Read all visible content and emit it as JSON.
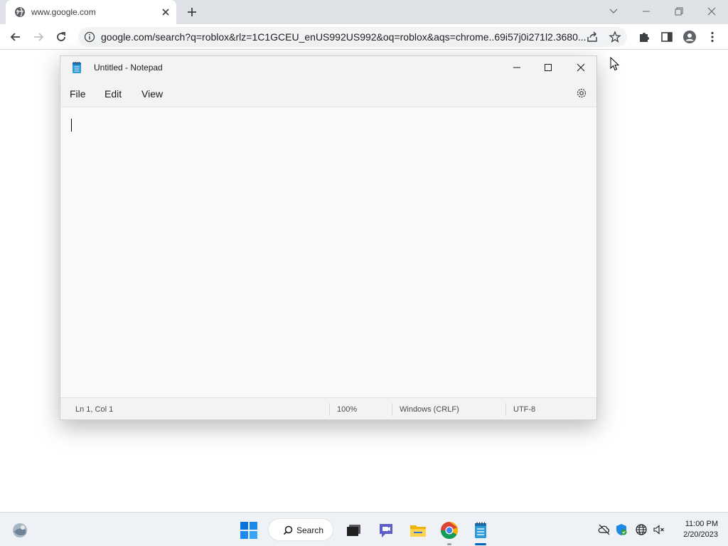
{
  "browser": {
    "tab": {
      "title": "www.google.com",
      "favicon": "globe-icon",
      "close_icon": "close-icon"
    },
    "new_tab_icon": "plus-icon",
    "window_controls": [
      "chevron-down-icon",
      "minimize-icon",
      "restore-icon",
      "close-icon"
    ],
    "toolbar": {
      "back_icon": "arrow-left-icon",
      "forward_icon": "arrow-right-icon",
      "reload_icon": "reload-icon",
      "url": "google.com/search?q=roblox&rlz=1C1GCEU_enUS992US992&oq=roblox&aqs=chrome..69i57j0i271l2.3680...",
      "extensions_icon": "puzzle-icon",
      "side_panel_icon": "side-panel-icon",
      "profile_icon": "person-icon",
      "menu_icon": "kebab-icon"
    }
  },
  "notepad": {
    "title": "Untitled - Notepad",
    "menu": [
      "File",
      "Edit",
      "View"
    ],
    "content": "",
    "status": {
      "position": "Ln 1, Col 1",
      "zoom": "100%",
      "line_ending": "Windows (CRLF)",
      "encoding": "UTF-8"
    }
  },
  "taskbar": {
    "search_label": "Search",
    "apps": [
      "widgets-icon",
      "start-icon",
      "task-view-icon",
      "teams-chat-icon",
      "file-explorer-icon",
      "chrome-icon",
      "notepad-icon"
    ],
    "tray_icons": [
      "cloud-offline-icon",
      "defender-icon",
      "network-icon",
      "volume-muted-icon"
    ],
    "time": "11:00 PM",
    "date": "2/20/2023"
  },
  "colors": {
    "accent": "#0067c0",
    "tabstrip": "#dee1e6",
    "omnibox": "#f1f3f4",
    "taskbar": "#eef1f6"
  }
}
